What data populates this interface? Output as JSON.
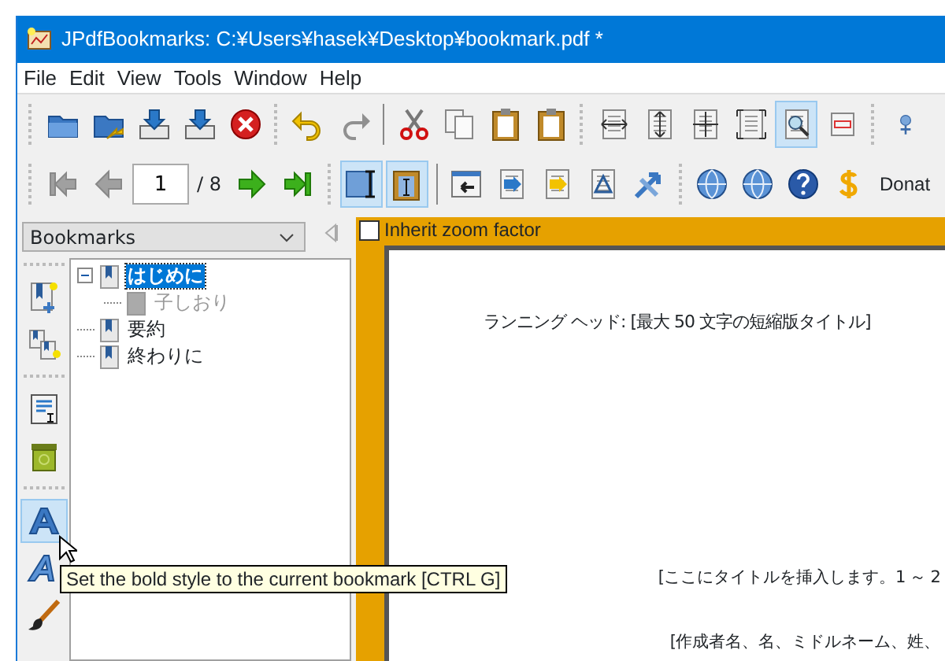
{
  "window": {
    "title": "JPdfBookmarks: C:¥Users¥hasek¥Desktop¥bookmark.pdf *"
  },
  "menu": [
    "File",
    "Edit",
    "View",
    "Tools",
    "Window",
    "Help"
  ],
  "toolbar_row_1": [
    {
      "kind": "grip"
    },
    {
      "kind": "folder",
      "pressed": false
    },
    {
      "kind": "folder-arrow",
      "pressed": false
    },
    {
      "kind": "tray",
      "pressed": false
    },
    {
      "kind": "tray",
      "pressed": false
    },
    {
      "kind": "stop",
      "pressed": false
    },
    {
      "kind": "grip"
    },
    {
      "kind": "undo",
      "pressed": false
    },
    {
      "kind": "redo",
      "pressed": false
    },
    {
      "kind": "separator"
    },
    {
      "kind": "scissors",
      "pressed": false
    },
    {
      "kind": "copy",
      "pressed": false
    },
    {
      "kind": "clipboard",
      "pressed": false
    },
    {
      "kind": "clipboard",
      "pressed": false
    },
    {
      "kind": "grip"
    },
    {
      "kind": "page-h",
      "pressed": false
    },
    {
      "kind": "page-v",
      "pressed": false
    },
    {
      "kind": "page-hv",
      "pressed": false
    },
    {
      "kind": "page-frame",
      "pressed": false
    },
    {
      "kind": "page-magnify",
      "pressed": true
    },
    {
      "kind": "page-rect",
      "pressed": false
    },
    {
      "kind": "grip"
    },
    {
      "kind": "person",
      "pressed": false
    }
  ],
  "toolbar_row_2": [
    {
      "kind": "grip"
    },
    {
      "kind": "first",
      "disabled": true
    },
    {
      "kind": "prev",
      "disabled": true
    },
    {
      "kind": "page-field",
      "value": "1"
    },
    {
      "kind": "page-count",
      "text": "/ 8"
    },
    {
      "kind": "next",
      "disabled": false
    },
    {
      "kind": "last",
      "disabled": false
    },
    {
      "kind": "grip"
    },
    {
      "kind": "text-cursor",
      "pressed": true
    },
    {
      "kind": "clipboard-cursor",
      "pressed": true
    },
    {
      "kind": "separator"
    },
    {
      "kind": "page-arrow",
      "pressed": false
    },
    {
      "kind": "page-down",
      "pressed": false
    },
    {
      "kind": "page-up",
      "pressed": false
    },
    {
      "kind": "triangle-page",
      "pressed": false
    },
    {
      "kind": "arrows",
      "pressed": false
    },
    {
      "kind": "grip"
    },
    {
      "kind": "globe",
      "pressed": false
    },
    {
      "kind": "globe",
      "pressed": false
    },
    {
      "kind": "help",
      "pressed": false
    },
    {
      "kind": "dollar",
      "pressed": false
    },
    {
      "kind": "label",
      "text": "Donat"
    }
  ],
  "panel_selector": {
    "value": "Bookmarks"
  },
  "side_toolbar": [
    {
      "kind": "grip"
    },
    {
      "kind": "bookmark-add",
      "hovered": false
    },
    {
      "kind": "bookmark-add-child",
      "hovered": false
    },
    {
      "kind": "grip"
    },
    {
      "kind": "properties",
      "hovered": false
    },
    {
      "kind": "trash",
      "hovered": false
    },
    {
      "kind": "grip"
    },
    {
      "kind": "bold",
      "hovered": true
    },
    {
      "kind": "italic",
      "hovered": false
    },
    {
      "kind": "brush",
      "hovered": false
    }
  ],
  "tree": [
    {
      "label": "はじめに",
      "selected": true,
      "dimmed": false,
      "expanded": true,
      "children": [
        {
          "label": "子しおり",
          "selected": false,
          "dimmed": true
        }
      ]
    },
    {
      "label": "要約",
      "selected": false,
      "dimmed": false
    },
    {
      "label": "終わりに",
      "selected": false,
      "dimmed": false
    }
  ],
  "inherit_zoom": {
    "label": "Inherit zoom factor",
    "checked": false
  },
  "page_lines": [
    "ランニング ヘッド: [最大 50 文字の短縮版タイトル]",
    "[ここにタイトルを挿入します。1 ～ 2",
    "[作成者名、名、ミドルネーム、姓、"
  ],
  "tooltip": "Set the bold style to the current bookmark [CTRL G]"
}
